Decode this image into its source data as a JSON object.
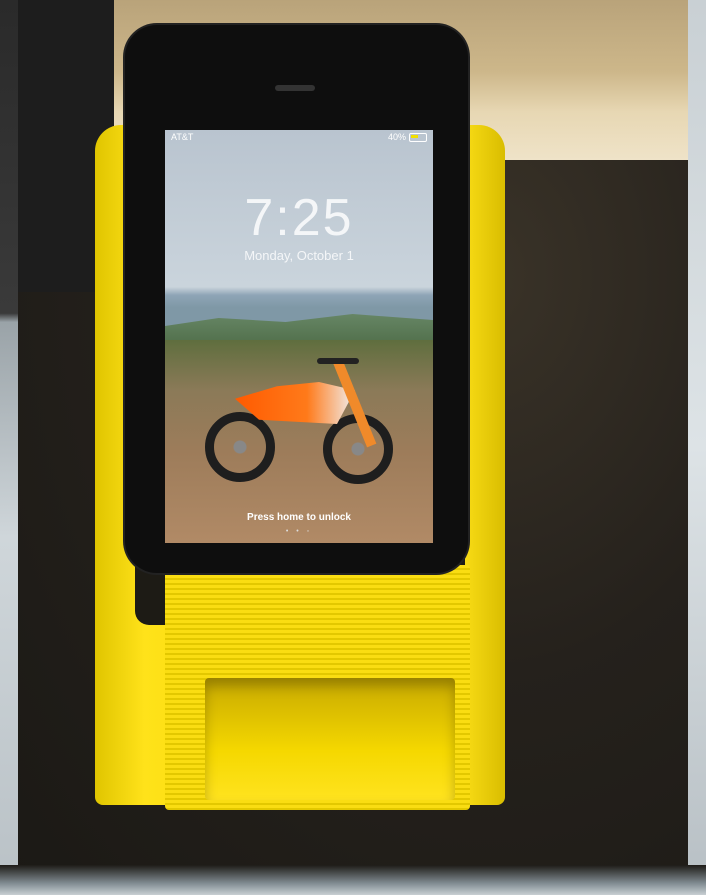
{
  "photo": {
    "subject": "phone-on-yellow-stand",
    "colors": {
      "stand": "#f5d900",
      "phone_body": "#0e0e0e",
      "table": "#25211c",
      "wall": "#cdb78a",
      "bike_accent": "#ff5a00"
    }
  },
  "phone_screen": {
    "status_bar": {
      "carrier": "AT&T",
      "battery": "40%"
    },
    "lock_time": "7:25",
    "lock_date": "Monday, October 1",
    "unlock_hint": "Press home to unlock",
    "page_dots": "• • ◦"
  }
}
